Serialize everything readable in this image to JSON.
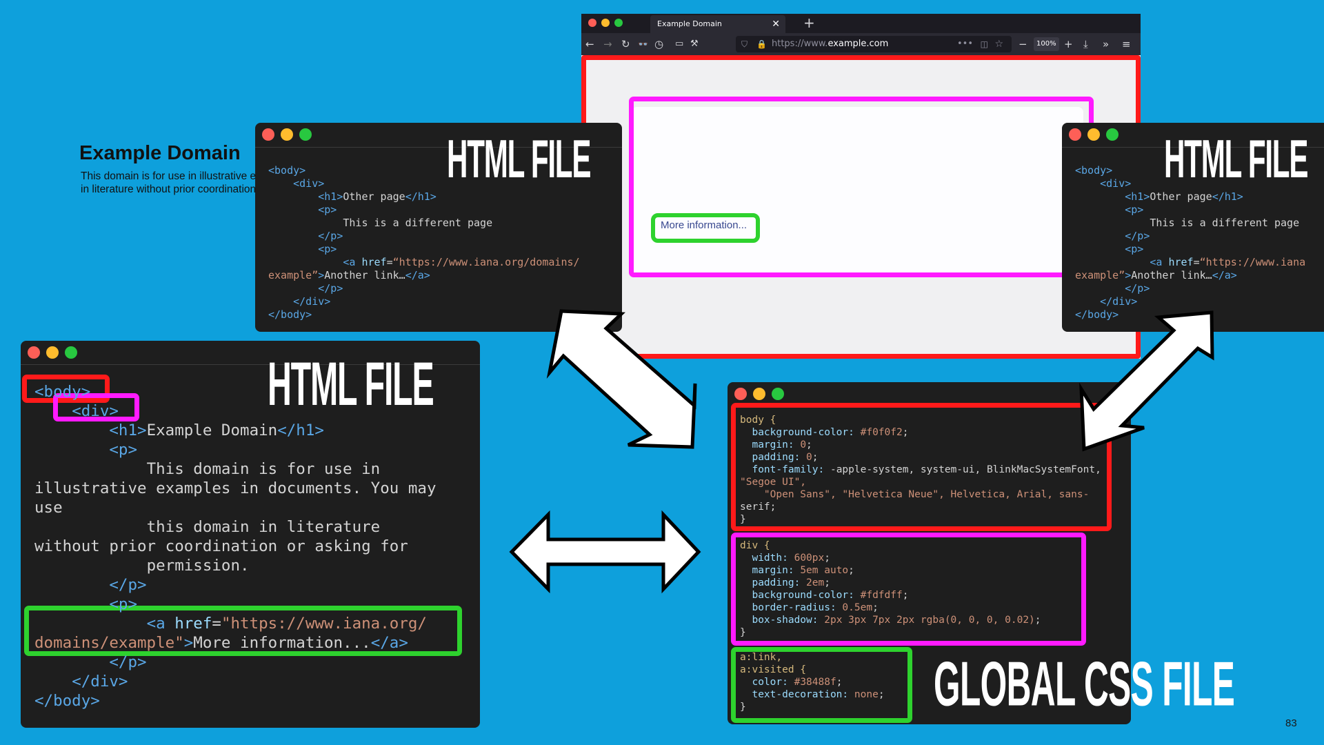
{
  "browser": {
    "tab_title": "Example Domain",
    "url_prefix": "https://www.",
    "url_domain": "example.com",
    "zoom": "100%",
    "page": {
      "heading": "Example Domain",
      "paragraph": "This domain is for use in illustrative examples in documents. You may use this domain in literature without prior coordination or asking for permission.",
      "link": "More information..."
    }
  },
  "labels": {
    "html_file": "HTML FILE",
    "css_file": "GLOBAL CSS FILE"
  },
  "other_page_html": {
    "body_open": "<body>",
    "div_open": "<div>",
    "h1_open": "<h1>",
    "h1_text": "Other page",
    "h1_close": "</h1>",
    "p_open": "<p>",
    "p_text": "This is a different page",
    "p_close": "</p>",
    "a_open": "<a ",
    "href_attr": "href",
    "href_val_1": "“https://www.iana.org/domains/",
    "href_val_2": "example”",
    "a_text": "Another link…",
    "a_close": "</a>",
    "div_close": "</div>",
    "body_close": "</body>"
  },
  "right_html": {
    "href_val_1": "“https://www.iana"
  },
  "main_html": {
    "body_open": "<body>",
    "div_open": "<div>",
    "h1_open": "<h1>",
    "h1_text": "Example Domain",
    "h1_close": "</h1>",
    "p_open": "<p>",
    "p_line1": "This domain is for use in",
    "p_line2": "illustrative examples in documents. You may",
    "p_line3": "use",
    "p_line4": "this domain in literature",
    "p_line5": "without prior coordination or asking for",
    "p_line6": "permission.",
    "p_close": "</p>",
    "a_open": "<a ",
    "href_attr": "href",
    "href_val_1": "\"https://www.iana.org/",
    "href_val_2": "domains/example\"",
    "a_text": "More information...",
    "a_close": "</a>",
    "div_close": "</div>",
    "body_close": "</body>"
  },
  "css": {
    "body_selector": "body {",
    "bg_prop": "background-color:",
    "bg_val": "#f0f0f2",
    "margin_prop": "margin:",
    "margin_val": "0",
    "padding_prop": "padding:",
    "padding_val": "0",
    "font_prop": "font-family:",
    "font_val1": "-apple-system, system-ui, BlinkMacSystemFont,",
    "font_val2": "\"Segoe UI\",",
    "font_val3": "\"Open Sans\", \"Helvetica Neue\", Helvetica, Arial, sans-",
    "font_val4": "serif;",
    "close": "}",
    "div_selector": "div {",
    "width_prop": "width:",
    "width_val": "600px",
    "dmargin_prop": "margin:",
    "dmargin_val": "5em auto",
    "dpadding_prop": "padding:",
    "dpadding_val": "2em",
    "dbg_prop": "background-color:",
    "dbg_val": "#fdfdff",
    "radius_prop": "border-radius:",
    "radius_val": "0.5em",
    "shadow_prop": "box-shadow:",
    "shadow_val": "2px 3px 7px 2px rgba(0, 0, 0, 0.02)",
    "a_selector1": "a:link,",
    "a_selector2": "a:visited {",
    "color_prop": "color:",
    "color_val": "#38488f",
    "td_prop": "text-decoration:",
    "td_val": "none"
  },
  "page_number": "83",
  "colors": {
    "background": "#0ea0dc",
    "highlight_body": "#ff1a1a",
    "highlight_div": "#ff1aff",
    "highlight_link": "#2ed22e"
  }
}
